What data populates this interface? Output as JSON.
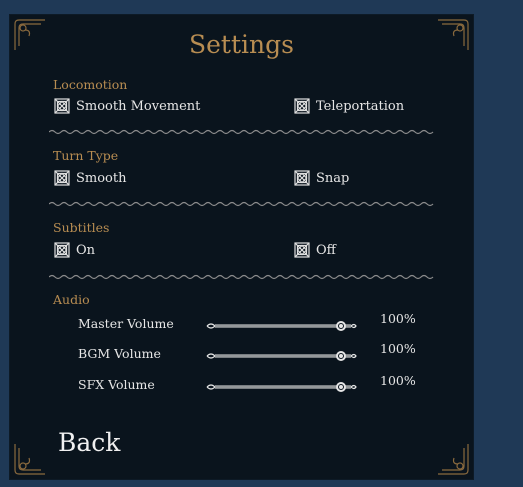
{
  "settings": {
    "title": "Settings",
    "sections": [
      {
        "label": "Locomotion",
        "options": [
          "Smooth Movement",
          "Teleportation"
        ]
      },
      {
        "label": "Turn Type",
        "options": [
          "Smooth",
          "Snap"
        ]
      },
      {
        "label": "Subtitles",
        "options": [
          "On",
          "Off"
        ]
      }
    ],
    "audio": {
      "label": "Audio",
      "sliders": [
        {
          "label": "Master Volume",
          "value_text": "100%",
          "level": 1.0
        },
        {
          "label": "BGM Volume",
          "value_text": "100%",
          "level": 1.0
        },
        {
          "label": "SFX Volume",
          "value_text": "100%",
          "level": 1.0
        }
      ]
    },
    "back_label": "Back"
  },
  "colors": {
    "background": "#1f3956",
    "panel": "#0a141d",
    "accent": "#b88d52",
    "text": "#e6e6e6"
  },
  "icons": {
    "checkbox": "ornate-checkbox-icon",
    "corner": "corner-ornament-icon",
    "divider": "ornamental-divider",
    "slider_handle": "slider-knob-icon"
  }
}
